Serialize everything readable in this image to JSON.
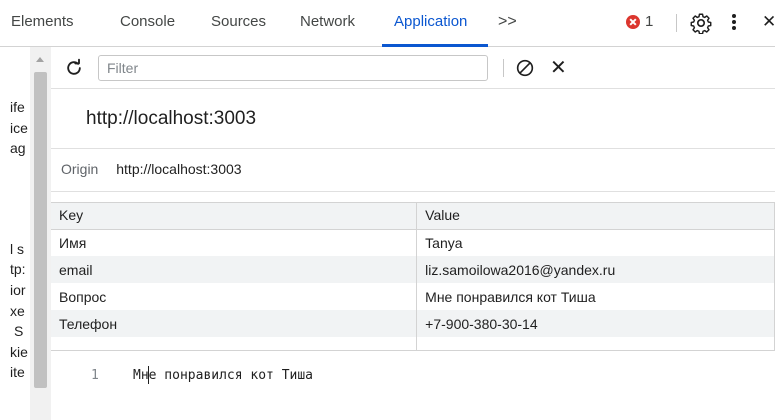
{
  "tabs": [
    {
      "label": "Elements",
      "active": false
    },
    {
      "label": "Console",
      "active": false
    },
    {
      "label": "Sources",
      "active": false
    },
    {
      "label": "Network",
      "active": false
    },
    {
      "label": "Application",
      "active": true
    }
  ],
  "overflow_label": ">>",
  "error_count": "1",
  "close_glyph": "✕",
  "left_fragments": [
    "ife",
    "ice",
    "ag",
    "l s",
    "tp:",
    "ior",
    "xe",
    "S",
    "kie",
    "ite"
  ],
  "toolbar": {
    "filter_placeholder": "Filter",
    "filter_value": "",
    "delete_glyph": "✕"
  },
  "origin": {
    "title": "http://localhost:3003",
    "label": "Origin",
    "value": "http://localhost:3003"
  },
  "table": {
    "columns": [
      "Key",
      "Value"
    ],
    "rows": [
      {
        "key": "Имя",
        "value": "Tanya"
      },
      {
        "key": "email",
        "value": "liz.samoilowa2016@yandex.ru"
      },
      {
        "key": "Вопрос",
        "value": "Мне понравился кот Тиша"
      },
      {
        "key": "Телефон",
        "value": "+7-900-380-30-14"
      }
    ]
  },
  "preview": {
    "line_number": "1",
    "text": "Мне понравился кот Тиша"
  },
  "colors": {
    "accent": "#0b57d0",
    "error": "#dc362e",
    "zebra": "#f1f3f4"
  },
  "icons": [
    "refresh-icon",
    "clear-icon",
    "delete-icon",
    "gear-icon",
    "kebab-menu-icon",
    "error-icon",
    "close-icon",
    "chevrons-right-icon"
  ]
}
